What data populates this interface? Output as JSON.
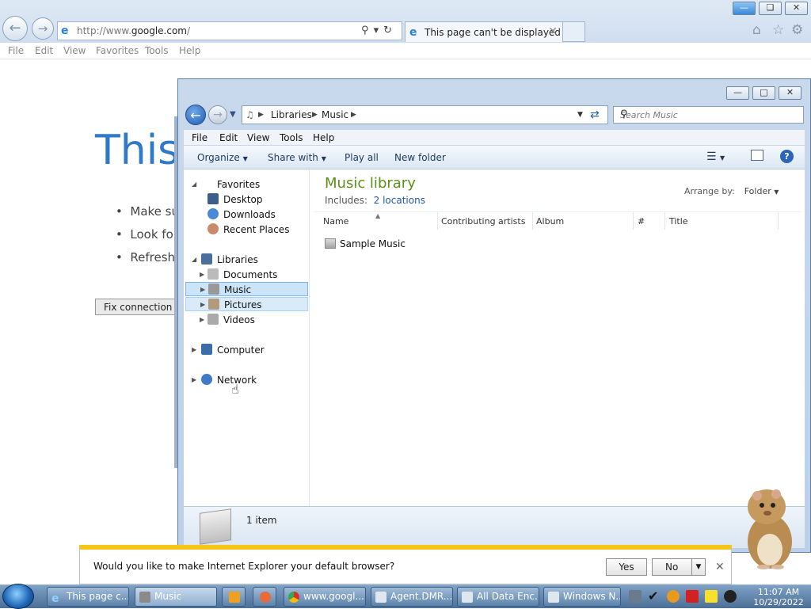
{
  "ie": {
    "url_prefix": "http://www.",
    "url_domain": "google.com",
    "url_suffix": "/",
    "tab_title": "This page can't be displayed",
    "menu": [
      "File",
      "Edit",
      "View",
      "Favorites",
      "Tools",
      "Help"
    ],
    "error_title": "This",
    "error_items": [
      "Make sur",
      "Look for",
      "Refresh t"
    ],
    "fix_button": "Fix connection pr"
  },
  "explorer": {
    "breadcrumb": [
      "Libraries",
      "Music"
    ],
    "search_placeholder": "Search Music",
    "menu": [
      "File",
      "Edit",
      "View",
      "Tools",
      "Help"
    ],
    "commands": {
      "organize": "Organize",
      "share": "Share with",
      "play": "Play all",
      "new_folder": "New folder"
    },
    "nav": {
      "favorites": "Favorites",
      "desktop": "Desktop",
      "downloads": "Downloads",
      "recent": "Recent Places",
      "libraries": "Libraries",
      "documents": "Documents",
      "music": "Music",
      "pictures": "Pictures",
      "videos": "Videos",
      "computer": "Computer",
      "network": "Network"
    },
    "library_title": "Music library",
    "library_includes_label": "Includes:",
    "library_includes_link": "2 locations",
    "arrange_label": "Arrange by:",
    "arrange_value": "Folder",
    "columns": [
      "Name",
      "Contributing artists",
      "Album",
      "#",
      "Title"
    ],
    "items": [
      "Sample Music"
    ],
    "status": "1 item"
  },
  "notification": {
    "text": "Would you like to make Internet Explorer your default browser?",
    "yes": "Yes",
    "no": "No"
  },
  "taskbar": {
    "items": [
      "This page c...",
      "Music",
      "",
      "",
      "www.googl...",
      "Agent.DMR...",
      "All Data Enc...",
      "Windows N..."
    ],
    "time": "11:07 AM",
    "date": "10/29/2022"
  }
}
